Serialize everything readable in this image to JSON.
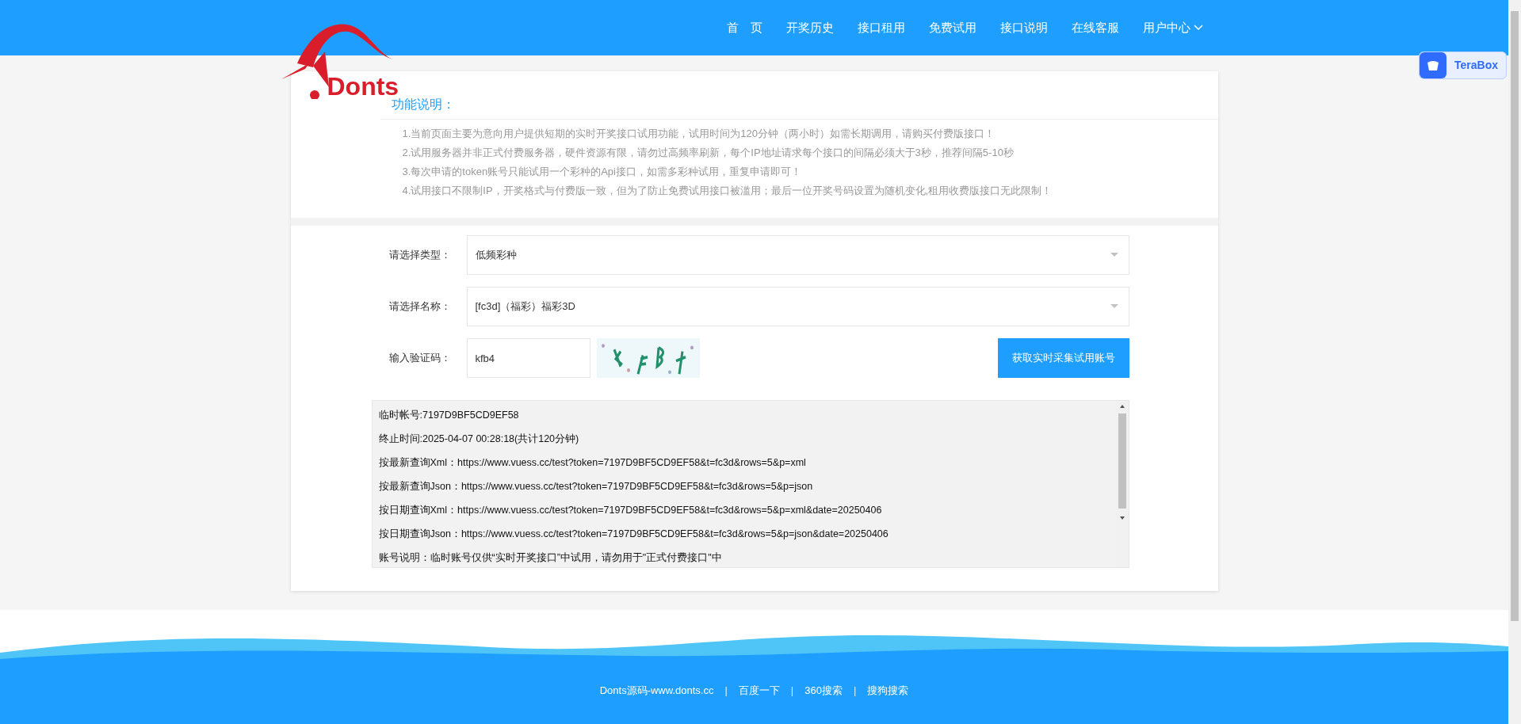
{
  "logo": {
    "text": "Donts"
  },
  "nav": [
    {
      "label": "首　页"
    },
    {
      "label": "开奖历史"
    },
    {
      "label": "接口租用"
    },
    {
      "label": "免费试用"
    },
    {
      "label": "接口说明"
    },
    {
      "label": "在线客服"
    },
    {
      "label": "用户中心",
      "dropdown": true
    }
  ],
  "terabox": {
    "label": "TeraBox"
  },
  "notice": {
    "title": "功能说明：",
    "items": [
      "1.当前页面主要为意向用户提供短期的实时开奖接口试用功能，试用时间为120分钟（两小时）如需长期调用，请购买付费版接口！",
      "2.试用服务器并非正式付费服务器，硬件资源有限，请勿过高频率刷新，每个IP地址请求每个接口的间隔必须大于3秒，推荐间隔5-10秒",
      "3.每次申请的token账号只能试用一个彩种的Api接口，如需多彩种试用，重复申请即可！",
      "4.试用接口不限制IP，开奖格式与付费版一致，但为了防止免费试用接口被滥用；最后一位开奖号码设置为随机变化,租用收费版接口无此限制！"
    ]
  },
  "form": {
    "type": {
      "label": "请选择类型：",
      "value": "低频彩种"
    },
    "name": {
      "label": "请选择名称：",
      "value": "[fc3d]（福彩）福彩3D"
    },
    "captcha": {
      "label": "输入验证码：",
      "value": "kfb4"
    },
    "submit": "获取实时采集试用账号"
  },
  "result": [
    "临时帐号:7197D9BF5CD9EF58",
    "终止时间:2025-04-07 00:28:18(共计120分钟)",
    "按最新查询Xml：https://www.vuess.cc/test?token=7197D9BF5CD9EF58&t=fc3d&rows=5&p=xml",
    "按最新查询Json：https://www.vuess.cc/test?token=7197D9BF5CD9EF58&t=fc3d&rows=5&p=json",
    "按日期查询Xml：https://www.vuess.cc/test?token=7197D9BF5CD9EF58&t=fc3d&rows=5&p=xml&date=20250406",
    "按日期查询Json：https://www.vuess.cc/test?token=7197D9BF5CD9EF58&t=fc3d&rows=5&p=json&date=20250406",
    "账号说明：临时账号仅供“实时开奖接口”中试用，请勿用于\"正式付费接口\"中"
  ],
  "footer": [
    {
      "kind": "link",
      "text": "Donts源码-www.donts.cc"
    },
    {
      "kind": "separator",
      "text": "|"
    },
    {
      "kind": "link",
      "text": "百度一下"
    },
    {
      "kind": "separator",
      "text": "|"
    },
    {
      "kind": "link",
      "text": "360搜索"
    },
    {
      "kind": "separator",
      "text": "|"
    },
    {
      "kind": "link",
      "text": "搜狗搜索"
    }
  ]
}
